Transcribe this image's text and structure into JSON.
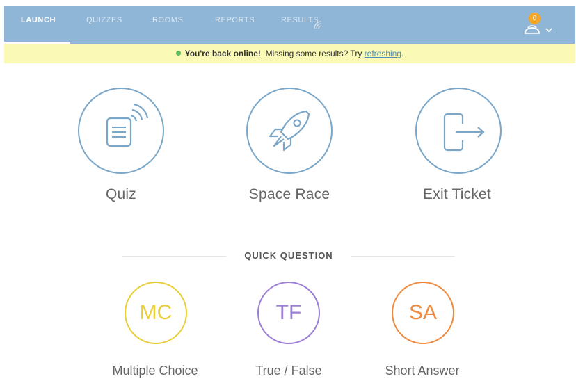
{
  "nav": {
    "items": [
      {
        "label": "LAUNCH"
      },
      {
        "label": "QUIZZES"
      },
      {
        "label": "ROOMS"
      },
      {
        "label": "REPORTS"
      },
      {
        "label": "RESULTS"
      }
    ],
    "active_index": 0,
    "notification_count": "0"
  },
  "banner": {
    "status_bold": "You're back online!",
    "text": "Missing some results? Try",
    "link": "refreshing",
    "end": "."
  },
  "launch": {
    "items": [
      {
        "label": "Quiz",
        "icon": "quiz-icon"
      },
      {
        "label": "Space Race",
        "icon": "rocket-icon"
      },
      {
        "label": "Exit Ticket",
        "icon": "exit-icon"
      }
    ]
  },
  "quick_question": {
    "title": "QUICK QUESTION",
    "items": [
      {
        "abbr": "MC",
        "label": "Multiple Choice",
        "color": "#e8cf3a"
      },
      {
        "abbr": "TF",
        "label": "True / False",
        "color": "#9b7fd4"
      },
      {
        "abbr": "SA",
        "label": "Short Answer",
        "color": "#f08a3e"
      }
    ]
  },
  "colors": {
    "nav_bg": "#8fb6d6",
    "banner_bg": "#fafab6",
    "icon_stroke": "#7aa6c8",
    "badge": "#f5a623",
    "online_dot": "#5cb85c"
  }
}
